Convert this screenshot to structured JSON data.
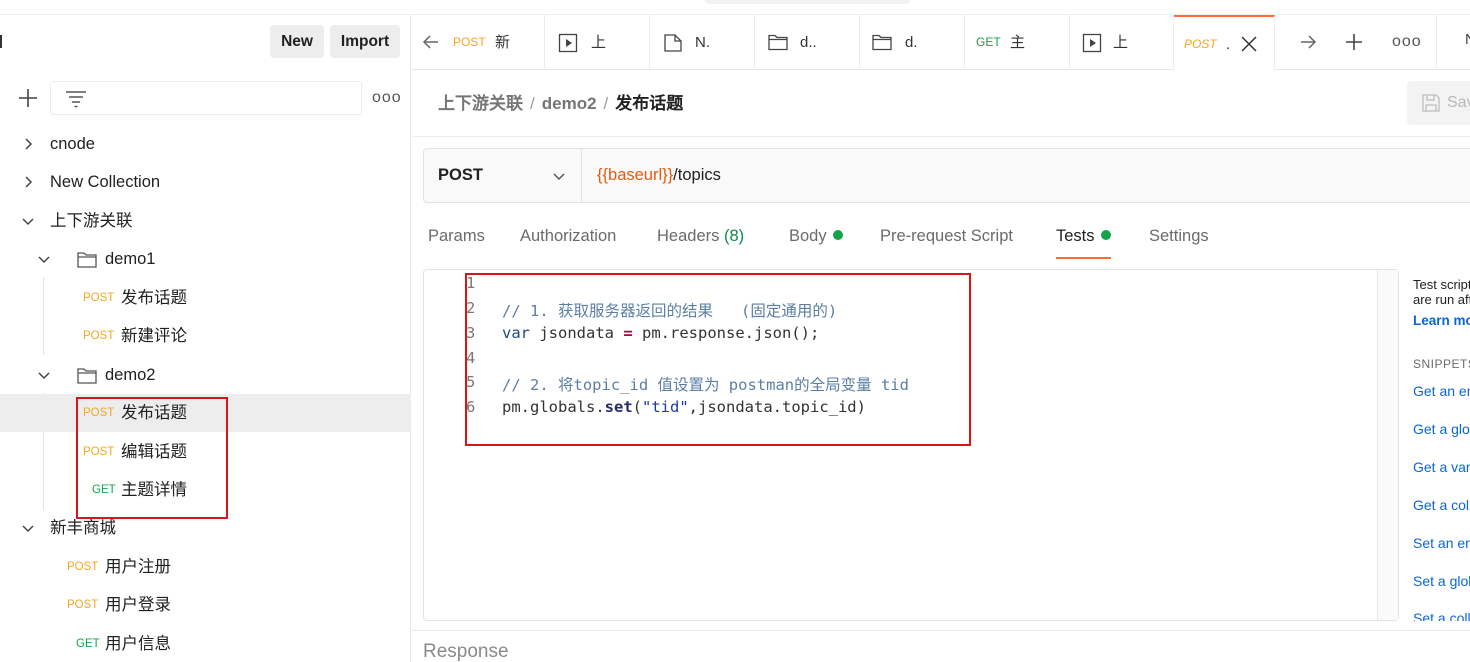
{
  "sidebar": {
    "new_label": "New",
    "import_label": "Import",
    "filter_placeholder": "",
    "more_label": "ooo",
    "tree": [
      {
        "label": "cnode"
      },
      {
        "label": "New Collection"
      },
      {
        "label": "上下游关联"
      },
      {
        "label": "demo1"
      },
      {
        "method": "POST",
        "label": "发布话题"
      },
      {
        "method": "POST",
        "label": "新建评论"
      },
      {
        "label": "demo2"
      },
      {
        "method": "POST",
        "label": "发布话题"
      },
      {
        "method": "POST",
        "label": "编辑话题"
      },
      {
        "method": "GET",
        "label": "主题详情"
      },
      {
        "label": "新丰商城"
      },
      {
        "method": "POST",
        "label": "用户注册"
      },
      {
        "method": "POST",
        "label": "用户登录"
      },
      {
        "method": "GET",
        "label": "用户信息"
      }
    ]
  },
  "tabs": [
    {
      "method": "POST",
      "label": "新"
    },
    {
      "label": "上"
    },
    {
      "label": "N."
    },
    {
      "label": "d.."
    },
    {
      "label": "d."
    },
    {
      "method": "GET",
      "label": "主"
    },
    {
      "label": "上"
    },
    {
      "method": "POST",
      "label": "."
    }
  ],
  "tabbar_more": "ooo",
  "breadcrumb": {
    "collection": "上下游关联",
    "folder": "demo2",
    "request": "发布话题",
    "separator": "/"
  },
  "save_label": "Save",
  "request": {
    "method": "POST",
    "url_var": "{{baseurl}}",
    "url_path": "/topics"
  },
  "request_tabs": {
    "params": "Params",
    "authorization": "Authorization",
    "headers": "Headers",
    "headers_count": "(8)",
    "body": "Body",
    "prerequest": "Pre-request Script",
    "tests": "Tests",
    "settings": "Settings"
  },
  "editor": {
    "line_numbers": [
      "1",
      "2",
      "3",
      "4",
      "5",
      "6"
    ],
    "code": {
      "l2_comment": "// 1. 获取服务器返回的结果   (固定通用的)",
      "l3_kw": "var",
      "l3_name": " jsondata ",
      "l3_op": "=",
      "l3_rest": " pm.response.json();",
      "l5_comment": "// 2. 将topic_id 值设置为 postman的全局变量 tid",
      "l6_obj": "pm.globals.",
      "l6_fn": "set",
      "l6_open": "(",
      "l6_str": "\"tid\"",
      "l6_rest": ",jsondata.topic_id)"
    }
  },
  "right_panel": {
    "intro_1": "Test scripts",
    "intro_2": "are run after",
    "learn_more": "Learn more",
    "snippets_heading": "SNIPPETS",
    "snippets": [
      "Get an environment variable",
      "Get a global variable",
      "Get a variable",
      "Get a collection variable",
      "Set an environment variable",
      "Set a global variable",
      "Set a collection variable"
    ]
  },
  "response_label": "Response",
  "colors": {
    "accent": "#ff6c37",
    "post": "#f5a623",
    "get": "#16a34a",
    "link": "#0a66d8",
    "annotation": "#d9151b"
  }
}
